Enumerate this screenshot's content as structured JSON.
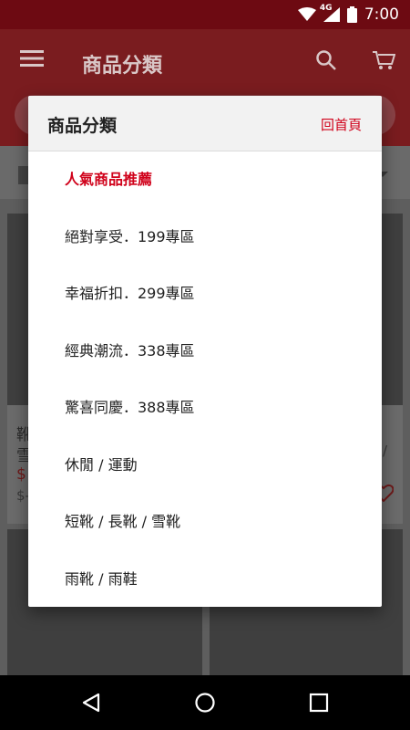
{
  "status_bar": {
    "time": "7:00",
    "network": "4G",
    "icons": [
      "wifi-icon",
      "cellular-icon",
      "battery-icon"
    ]
  },
  "app_bar": {
    "title": "商品分類",
    "icons": [
      "menu-icon",
      "search-icon",
      "cart-icon"
    ]
  },
  "background_peek": {
    "left_text_1": "靴",
    "left_text_2": "雪",
    "left_price": "$",
    "left_old_price": "$-",
    "right_text_1": "/"
  },
  "dialog": {
    "title": "商品分類",
    "home_link": "回首頁",
    "items": [
      {
        "label": "人氣商品推薦",
        "active": true
      },
      {
        "label": "絕對享受．199專區",
        "active": false
      },
      {
        "label": "幸福折扣．299專區",
        "active": false
      },
      {
        "label": "經典潮流．338專區",
        "active": false
      },
      {
        "label": "驚喜同慶．388專區",
        "active": false
      },
      {
        "label": "休閒 / 運動",
        "active": false
      },
      {
        "label": "短靴 / 長靴 / 雪靴",
        "active": false
      },
      {
        "label": "雨靴 / 雨鞋",
        "active": false
      }
    ]
  },
  "colors": {
    "accent": "#d0021b",
    "status_bar": "#6d0a12",
    "app_bar_dimmed": "#7a1c1f"
  },
  "nav_bar": {
    "icons": [
      "back-icon",
      "home-icon",
      "recents-icon"
    ]
  }
}
